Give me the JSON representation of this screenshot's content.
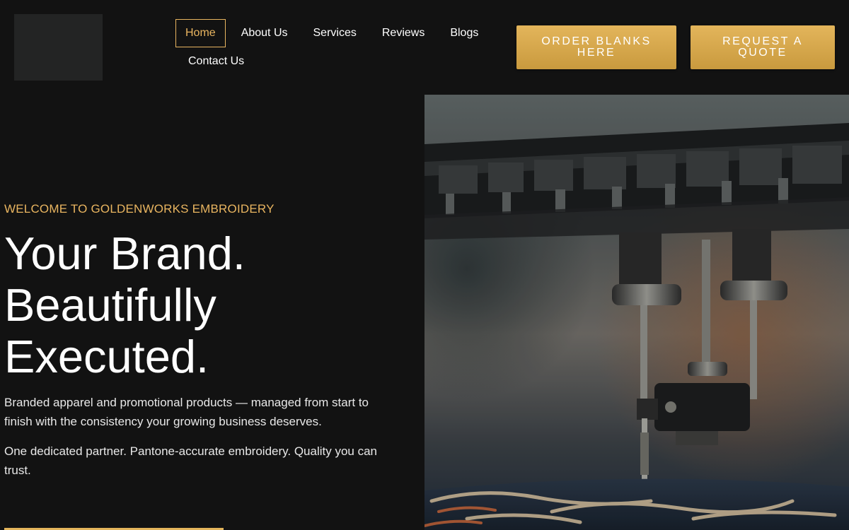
{
  "nav": {
    "items": [
      {
        "label": "Home"
      },
      {
        "label": "About Us"
      },
      {
        "label": "Services"
      },
      {
        "label": "Reviews"
      },
      {
        "label": "Blogs"
      },
      {
        "label": "Contact Us"
      }
    ],
    "active": "Home"
  },
  "header": {
    "order_button": "ORDER BLANKS HERE",
    "quote_button": "REQUEST A QUOTE"
  },
  "hero": {
    "eyebrow": "WELCOME TO GOLDENWORKS EMBROIDERY",
    "headline": [
      "Your Brand.",
      "Beautifully",
      "Executed."
    ],
    "paragraph1": " Branded apparel and promotional products — managed from start to finish with the consistency your growing business deserves.",
    "paragraph2": "One dedicated partner. Pantone-accurate embroidery. Quality you can trust.",
    "image_subject": "embroidery-machine-needle"
  },
  "colors": {
    "background": "#121212",
    "accent": "#e9b560",
    "button_gold": "#d4a84c",
    "text": "#ffffff"
  }
}
